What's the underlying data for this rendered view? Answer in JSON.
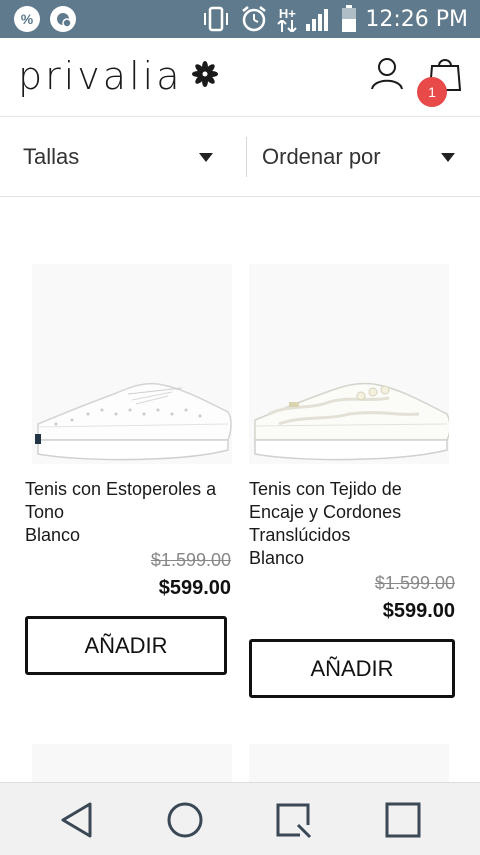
{
  "status_bar": {
    "time": "12:26 PM",
    "icons": [
      "percent-icon",
      "app-notification-icon",
      "vibrate-icon",
      "alarm-icon",
      "hplus-data-icon",
      "signal-icon",
      "battery-icon"
    ],
    "hplus_label": "H+",
    "percent_label": "%"
  },
  "header": {
    "logo_text": "privalia",
    "cart_count": "1"
  },
  "filters": {
    "sizes_label": "Tallas",
    "sort_label": "Ordenar por"
  },
  "products": [
    {
      "title": "Tenis con Estoperoles a Tono",
      "color": "Blanco",
      "old_price": "$1.599.00",
      "price": "$599.00",
      "button_label": "AÑADIR"
    },
    {
      "title": "Tenis con Tejido de Encaje y Cordones Translúcidos",
      "color": "Blanco",
      "old_price": "$1.599.00",
      "price": "$599.00",
      "button_label": "AÑADIR"
    }
  ],
  "colors": {
    "status_bar_bg": "#5f7a8c",
    "badge": "#e84a4a",
    "text": "#1a1a1a"
  },
  "navbar": {
    "icons": [
      "back-icon",
      "home-icon",
      "recents-icon",
      "overview-icon"
    ]
  }
}
